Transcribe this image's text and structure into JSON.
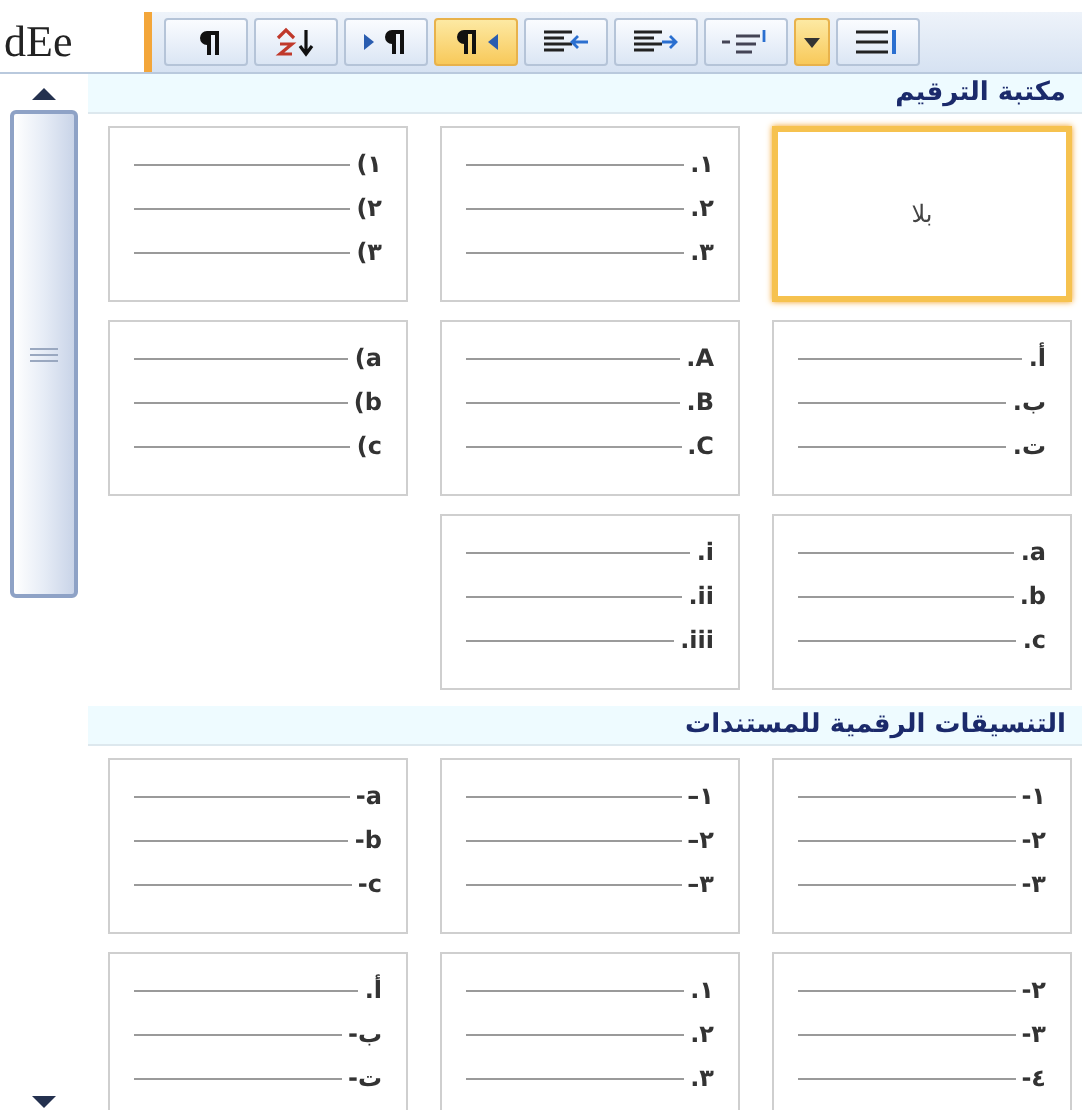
{
  "ribbon": {
    "style_preview": "dEe",
    "buttons": [
      {
        "kind": "pilcrow",
        "selected": false
      },
      {
        "kind": "sort",
        "selected": false
      },
      {
        "kind": "ltr",
        "selected": false
      },
      {
        "kind": "rtl",
        "selected": true
      },
      {
        "kind": "indent-left",
        "selected": false
      },
      {
        "kind": "indent-right",
        "selected": false
      },
      {
        "kind": "spacing",
        "selected": false
      },
      {
        "kind": "dropdown",
        "selected": true
      },
      {
        "kind": "list",
        "selected": false
      }
    ]
  },
  "sections": [
    {
      "title": "مكتبة الترقيم",
      "items": [
        {
          "kind": "none",
          "label": "بلا",
          "selected": true
        },
        {
          "kind": "list",
          "lines": [
            ".١",
            ".٢",
            ".٣"
          ],
          "selected": false
        },
        {
          "kind": "list",
          "lines": [
            "(١",
            "(٢",
            "(٣"
          ],
          "selected": false
        },
        {
          "kind": "list",
          "lines": [
            ".أ",
            ".ب",
            ".ت"
          ],
          "selected": false
        },
        {
          "kind": "list",
          "lines": [
            ".A",
            ".B",
            ".C"
          ],
          "selected": false
        },
        {
          "kind": "list",
          "lines": [
            "(a",
            "(b",
            "(c"
          ],
          "selected": false
        },
        {
          "kind": "list",
          "lines": [
            ".a",
            ".b",
            ".c"
          ],
          "selected": false
        },
        {
          "kind": "list",
          "lines": [
            ".i",
            ".ii",
            ".iii"
          ],
          "selected": false
        }
      ]
    },
    {
      "title": "التنسيقات الرقمية للمستندات",
      "items": [
        {
          "kind": "list",
          "lines": [
            "-١",
            "-٢",
            "-٣"
          ],
          "selected": false
        },
        {
          "kind": "list",
          "lines": [
            "–١",
            "–٢",
            "–٣"
          ],
          "selected": false
        },
        {
          "kind": "list",
          "lines": [
            "-a",
            "-b",
            "-c"
          ],
          "selected": false
        },
        {
          "kind": "list",
          "lines": [
            "-٢",
            "-٣",
            "-٤"
          ],
          "selected": false
        },
        {
          "kind": "list",
          "lines": [
            ".١",
            ".٢",
            ".٣"
          ],
          "selected": false
        },
        {
          "kind": "list",
          "lines": [
            ".أ",
            "-ب",
            "-ت"
          ],
          "selected": false
        }
      ]
    }
  ]
}
